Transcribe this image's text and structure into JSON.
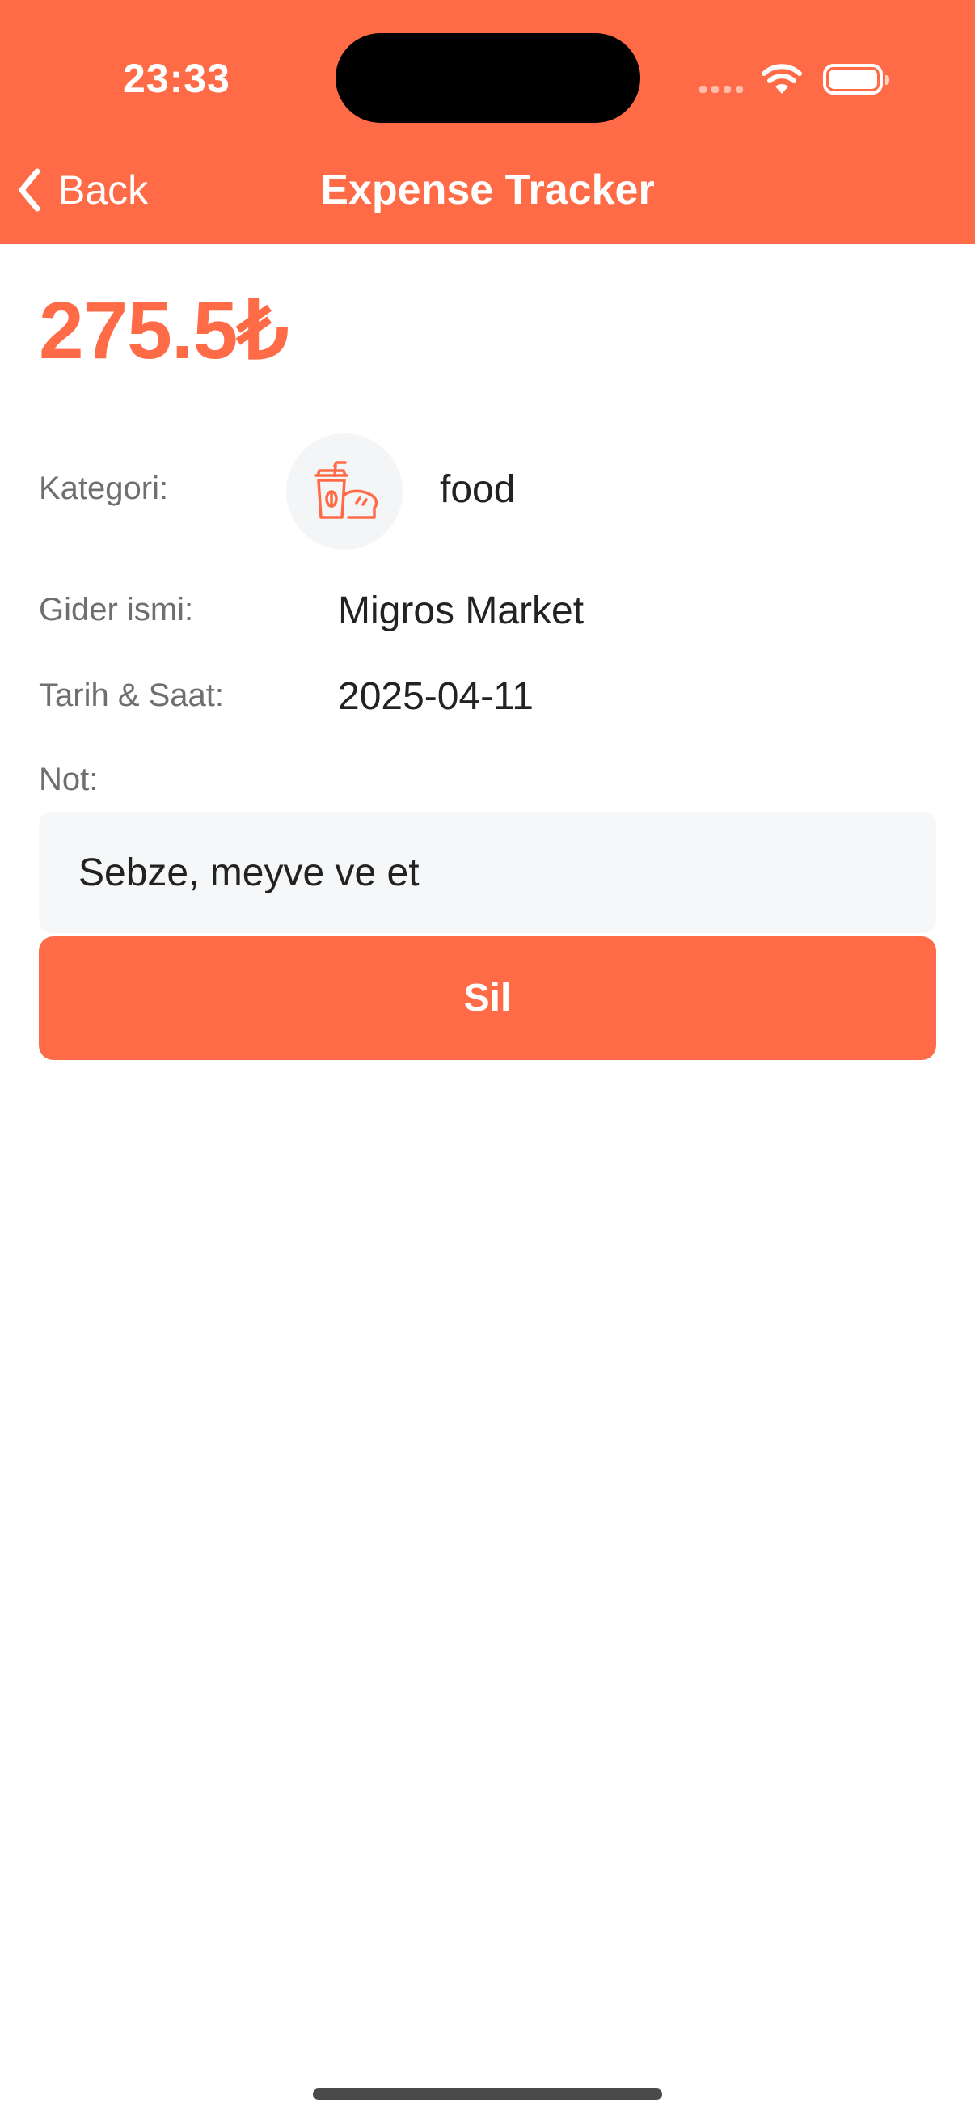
{
  "status_bar": {
    "time": "23:33"
  },
  "nav": {
    "back_label": "Back",
    "title": "Expense Tracker"
  },
  "expense": {
    "amount": "275.5₺",
    "category_label": "Kategori:",
    "category_value": "food",
    "category_icon": "food-drink-icon",
    "name_label": "Gider ismi:",
    "name_value": "Migros Market",
    "datetime_label": "Tarih & Saat:",
    "datetime_value": "2025-04-11",
    "note_label": "Not:",
    "note_value": "Sebze, meyve ve et"
  },
  "actions": {
    "delete_label": "Sil"
  },
  "colors": {
    "accent": "#FF6A47",
    "note_background": "#F6F7F8"
  }
}
